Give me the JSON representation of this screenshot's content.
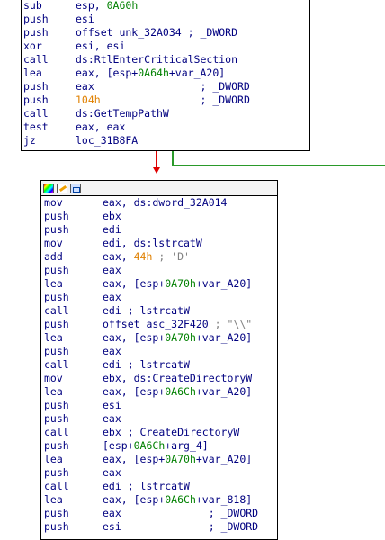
{
  "top_block": {
    "lines": [
      {
        "mnemonic": "sub",
        "parts": [
          {
            "t": "esp, ",
            "c": "ops"
          },
          {
            "t": "0A60h",
            "c": "num"
          }
        ]
      },
      {
        "mnemonic": "push",
        "parts": [
          {
            "t": "esi",
            "c": "ops"
          }
        ]
      },
      {
        "mnemonic": "push",
        "parts": [
          {
            "t": "offset unk_32A034 ; _DWORD",
            "c": "ops"
          }
        ]
      },
      {
        "mnemonic": "xor",
        "parts": [
          {
            "t": "esi, esi",
            "c": "ops"
          }
        ]
      },
      {
        "mnemonic": "call",
        "parts": [
          {
            "t": "ds:RtlEnterCriticalSection",
            "c": "ops"
          }
        ]
      },
      {
        "mnemonic": "lea",
        "parts": [
          {
            "t": "eax, [esp+",
            "c": "ops"
          },
          {
            "t": "0A64h",
            "c": "num"
          },
          {
            "t": "+var_A20]",
            "c": "ops"
          }
        ]
      },
      {
        "mnemonic": "push",
        "parts": [
          {
            "t": "eax                 ; _DWORD",
            "c": "ops"
          }
        ]
      },
      {
        "mnemonic": "push",
        "parts": [
          {
            "t": "104h",
            "c": "hexo"
          },
          {
            "t": "                ; _DWORD",
            "c": "ops"
          }
        ]
      },
      {
        "mnemonic": "call",
        "parts": [
          {
            "t": "ds:GetTempPathW",
            "c": "ops"
          }
        ]
      },
      {
        "mnemonic": "test",
        "parts": [
          {
            "t": "eax, eax",
            "c": "ops"
          }
        ]
      },
      {
        "mnemonic": "jz",
        "parts": [
          {
            "t": "loc_31B8FA",
            "c": "ops"
          }
        ]
      }
    ]
  },
  "bottom_block": {
    "toolbar_icons": [
      "color-palette-icon",
      "edit-node-icon",
      "graph-view-icon"
    ],
    "lines": [
      {
        "mnemonic": "mov",
        "parts": [
          {
            "t": "eax, ds:dword_32A014",
            "c": "ops"
          }
        ]
      },
      {
        "mnemonic": "push",
        "parts": [
          {
            "t": "ebx",
            "c": "ops"
          }
        ]
      },
      {
        "mnemonic": "push",
        "parts": [
          {
            "t": "edi",
            "c": "ops"
          }
        ]
      },
      {
        "mnemonic": "mov",
        "parts": [
          {
            "t": "edi, ds:lstrcatW",
            "c": "ops"
          }
        ]
      },
      {
        "mnemonic": "add",
        "parts": [
          {
            "t": "eax, ",
            "c": "ops"
          },
          {
            "t": "44h",
            "c": "hexo"
          },
          {
            "t": " ; 'D'",
            "c": "cmt"
          }
        ]
      },
      {
        "mnemonic": "push",
        "parts": [
          {
            "t": "eax",
            "c": "ops"
          }
        ]
      },
      {
        "mnemonic": "lea",
        "parts": [
          {
            "t": "eax, [esp+",
            "c": "ops"
          },
          {
            "t": "0A70h",
            "c": "num"
          },
          {
            "t": "+var_A20]",
            "c": "ops"
          }
        ]
      },
      {
        "mnemonic": "push",
        "parts": [
          {
            "t": "eax",
            "c": "ops"
          }
        ]
      },
      {
        "mnemonic": "call",
        "parts": [
          {
            "t": "edi ",
            "c": "ops"
          },
          {
            "t": "; lstrcatW",
            "c": "name"
          }
        ]
      },
      {
        "mnemonic": "push",
        "parts": [
          {
            "t": "offset asc_32F420 ",
            "c": "ops"
          },
          {
            "t": "; \"\\\\\"",
            "c": "cmt"
          }
        ]
      },
      {
        "mnemonic": "lea",
        "parts": [
          {
            "t": "eax, [esp+",
            "c": "ops"
          },
          {
            "t": "0A70h",
            "c": "num"
          },
          {
            "t": "+var_A20]",
            "c": "ops"
          }
        ]
      },
      {
        "mnemonic": "push",
        "parts": [
          {
            "t": "eax",
            "c": "ops"
          }
        ]
      },
      {
        "mnemonic": "call",
        "parts": [
          {
            "t": "edi ",
            "c": "ops"
          },
          {
            "t": "; lstrcatW",
            "c": "name"
          }
        ]
      },
      {
        "mnemonic": "mov",
        "parts": [
          {
            "t": "ebx, ds:CreateDirectoryW",
            "c": "ops"
          }
        ]
      },
      {
        "mnemonic": "lea",
        "parts": [
          {
            "t": "eax, [esp+",
            "c": "ops"
          },
          {
            "t": "0A6Ch",
            "c": "num"
          },
          {
            "t": "+var_A20]",
            "c": "ops"
          }
        ]
      },
      {
        "mnemonic": "push",
        "parts": [
          {
            "t": "esi",
            "c": "ops"
          }
        ]
      },
      {
        "mnemonic": "push",
        "parts": [
          {
            "t": "eax",
            "c": "ops"
          }
        ]
      },
      {
        "mnemonic": "call",
        "parts": [
          {
            "t": "ebx ",
            "c": "ops"
          },
          {
            "t": "; CreateDirectoryW",
            "c": "name"
          }
        ]
      },
      {
        "mnemonic": "push",
        "parts": [
          {
            "t": "[esp+",
            "c": "ops"
          },
          {
            "t": "0A6Ch",
            "c": "num"
          },
          {
            "t": "+arg_4]",
            "c": "ops"
          }
        ]
      },
      {
        "mnemonic": "lea",
        "parts": [
          {
            "t": "eax, [esp+",
            "c": "ops"
          },
          {
            "t": "0A70h",
            "c": "num"
          },
          {
            "t": "+var_A20]",
            "c": "ops"
          }
        ]
      },
      {
        "mnemonic": "push",
        "parts": [
          {
            "t": "eax",
            "c": "ops"
          }
        ]
      },
      {
        "mnemonic": "call",
        "parts": [
          {
            "t": "edi ",
            "c": "ops"
          },
          {
            "t": "; lstrcatW",
            "c": "name"
          }
        ]
      },
      {
        "mnemonic": "lea",
        "parts": [
          {
            "t": "eax, [esp+",
            "c": "ops"
          },
          {
            "t": "0A6Ch",
            "c": "num"
          },
          {
            "t": "+var_818]",
            "c": "ops"
          }
        ]
      },
      {
        "mnemonic": "push",
        "parts": [
          {
            "t": "eax              ; _DWORD",
            "c": "ops"
          }
        ]
      },
      {
        "mnemonic": "push",
        "parts": [
          {
            "t": "esi              ; _DWORD",
            "c": "ops"
          }
        ]
      }
    ]
  },
  "colors": {
    "mnemonic": "#000080",
    "number": "#008000",
    "immediate": "#e08000",
    "false_edge": "#e00000",
    "true_edge": "#2a9a2a"
  }
}
